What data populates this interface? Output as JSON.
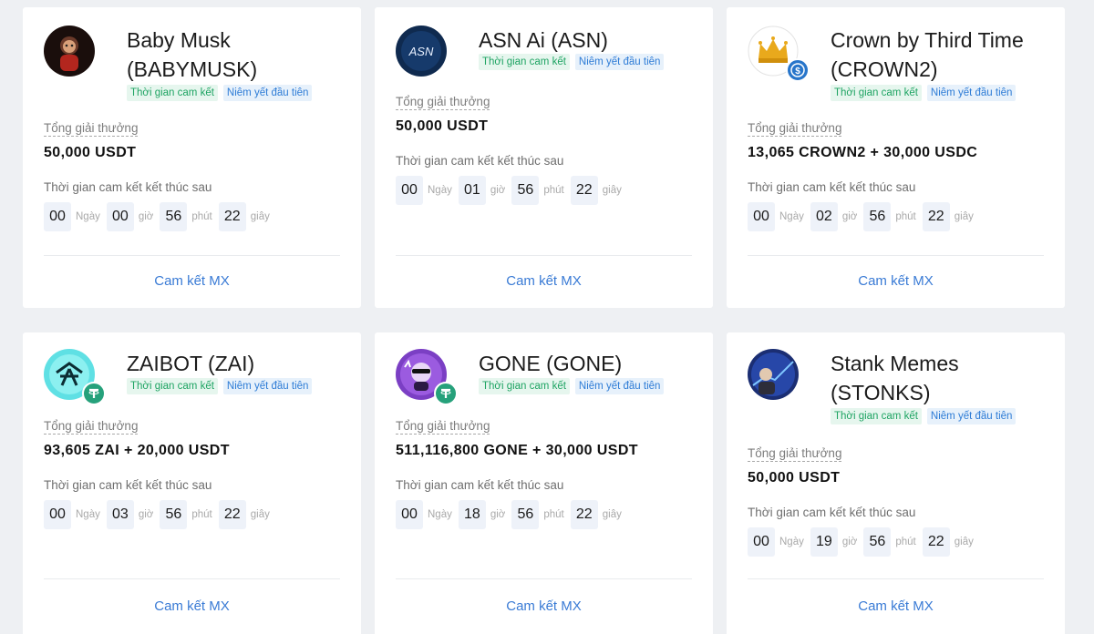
{
  "colors": {
    "background": "#eef0f3",
    "card": "#ffffff",
    "tag_green_bg": "#e6f6ee",
    "tag_green_text": "#1fa463",
    "tag_blue_bg": "#e7f1fb",
    "tag_blue_text": "#2e7cd6",
    "cta": "#3a7bd5",
    "countdown_box": "#eef2f9"
  },
  "common": {
    "tag_commit": "Thời gian cam kết",
    "tag_listing": "Niêm yết đầu tiên",
    "prize_label": "Tổng giải thưởng",
    "ends_label": "Thời gian cam kết kết thúc sau",
    "unit_days": "Ngày",
    "unit_hours": "giờ",
    "unit_minutes": "phút",
    "unit_seconds": "giây",
    "cta_label": "Cam kết MX"
  },
  "cards": [
    {
      "name": "Baby Musk (BABYMUSK)",
      "icon": "baby-musk-logo",
      "prize": "50,000 USDT",
      "countdown": {
        "days": "00",
        "hours": "00",
        "minutes": "56",
        "seconds": "22"
      }
    },
    {
      "name": "ASN Ai (ASN)",
      "icon": "asn-logo",
      "prize": "50,000 USDT",
      "countdown": {
        "days": "00",
        "hours": "01",
        "minutes": "56",
        "seconds": "22"
      }
    },
    {
      "name": "Crown by Third Time (CROWN2)",
      "icon": "crown-logo",
      "badge_icon": "usdc-badge",
      "prize": "13,065 CROWN2 + 30,000 USDC",
      "countdown": {
        "days": "00",
        "hours": "02",
        "minutes": "56",
        "seconds": "22"
      }
    },
    {
      "name": "ZAIBOT (ZAI)",
      "icon": "zaibot-logo",
      "badge_icon": "usdt-badge",
      "prize": "93,605 ZAI + 20,000 USDT",
      "countdown": {
        "days": "00",
        "hours": "03",
        "minutes": "56",
        "seconds": "22"
      }
    },
    {
      "name": "GONE (GONE)",
      "icon": "gone-logo",
      "badge_icon": "usdt-badge",
      "prize": "511,116,800 GONE + 30,000 USDT",
      "countdown": {
        "days": "00",
        "hours": "18",
        "minutes": "56",
        "seconds": "22"
      }
    },
    {
      "name": "Stank Memes (STONKS)",
      "icon": "stonks-logo",
      "prize": "50,000 USDT",
      "countdown": {
        "days": "00",
        "hours": "19",
        "minutes": "56",
        "seconds": "22"
      }
    }
  ]
}
